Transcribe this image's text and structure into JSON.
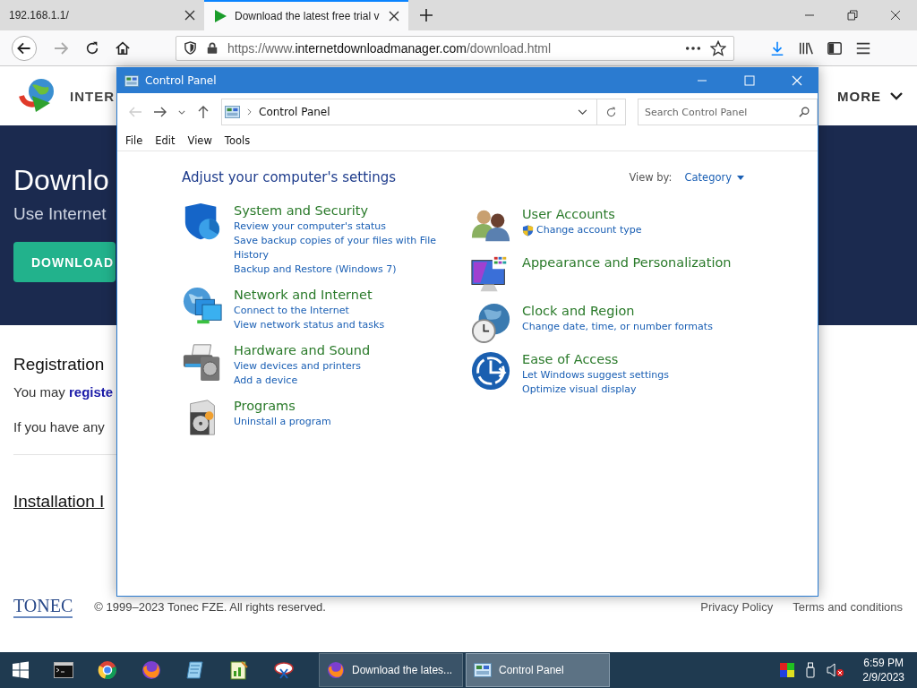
{
  "browser": {
    "tabs": [
      {
        "title": "192.168.1.1/",
        "selected": false
      },
      {
        "title": "Download the latest free trial v",
        "selected": true
      }
    ],
    "back": {
      "disabled": false
    },
    "forward": {
      "disabled": true
    },
    "url": {
      "prefix": "https://www.",
      "domain": "internetdownloadmanager.com",
      "path": "/download.html"
    }
  },
  "page": {
    "brand": "INTER",
    "menu": "MORE",
    "hero": {
      "title": "Downlo",
      "subtitle": "Use Internet",
      "button": "DOWNLOAD"
    },
    "registration": {
      "heading": "Registration",
      "text": "You may",
      "link": "registe",
      "line_2": "If you have any"
    },
    "installation_heading": "Installation I",
    "footer": {
      "logo": "TONEC",
      "copyright": "© 1999–2023 Tonec FZE. All rights reserved.",
      "links": [
        "Privacy Policy",
        "Terms and conditions"
      ]
    }
  },
  "control_panel": {
    "title": "Control Panel",
    "back": {
      "disabled": true
    },
    "forward": {
      "disabled": false
    },
    "address": "Control Panel",
    "search": {
      "placeholder": "Search Control Panel"
    },
    "menu": [
      "File",
      "Edit",
      "View",
      "Tools"
    ],
    "heading": "Adjust your computer's settings",
    "view_by_label": "View by:",
    "view_by_value": "Category",
    "columns": [
      [
        {
          "title": "System and Security",
          "links": [
            {
              "text": "Review your computer's status",
              "admin": false
            },
            {
              "text": "Save backup copies of your files with File History",
              "admin": false
            },
            {
              "text": "Backup and Restore (Windows 7)",
              "admin": false
            }
          ]
        },
        {
          "title": "Network and Internet",
          "links": [
            {
              "text": "Connect to the Internet",
              "admin": false
            },
            {
              "text": "View network status and tasks",
              "admin": false
            }
          ]
        },
        {
          "title": "Hardware and Sound",
          "links": [
            {
              "text": "View devices and printers",
              "admin": false
            },
            {
              "text": "Add a device",
              "admin": false
            }
          ]
        },
        {
          "title": "Programs",
          "links": [
            {
              "text": "Uninstall a program",
              "admin": false
            }
          ]
        }
      ],
      [
        {
          "title": "User Accounts",
          "links": [
            {
              "text": "Change account type",
              "admin": true
            }
          ]
        },
        {
          "title": "Appearance and Personalization"
        },
        {
          "title": "Clock and Region",
          "links": [
            {
              "text": "Change date, time, or number formats",
              "admin": false
            }
          ]
        },
        {
          "title": "Ease of Access",
          "links": [
            {
              "text": "Let Windows suggest settings",
              "admin": false
            },
            {
              "text": "Optimize visual display",
              "admin": false
            }
          ]
        }
      ]
    ]
  },
  "taskbar": {
    "windows": [
      {
        "label": "Download the lates...",
        "selected": false
      },
      {
        "label": "Control Panel",
        "selected": true
      }
    ],
    "time": "6:59 PM",
    "date": "2/9/2023"
  }
}
